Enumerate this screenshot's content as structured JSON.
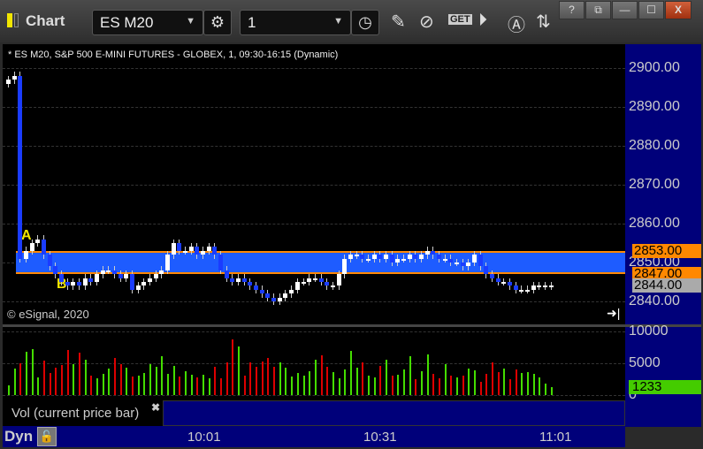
{
  "window": {
    "title": "Chart",
    "buttons": [
      "?",
      "⧉",
      "—",
      "☐",
      "X"
    ]
  },
  "toolbar": {
    "symbol": "ES M20",
    "interval": "1",
    "icons": [
      "settings-icon",
      "clock-icon",
      "pencil-icon",
      "studies-icon",
      "get-icon",
      "play-icon",
      "alert-icon",
      "link-icon"
    ]
  },
  "chart": {
    "info": "* ES M20, S&P 500 E-MINI FUTURES - GLOBEX, 1, 09:30-16:15 (Dynamic)",
    "copyright": "© eSignal, 2020",
    "price_ticks": [
      "2900.00",
      "2890.00",
      "2880.00",
      "2870.00",
      "2860.00",
      "2850.00",
      "2840.00"
    ],
    "price_values": [
      2900,
      2890,
      2880,
      2870,
      2860,
      2850,
      2840
    ],
    "zone": {
      "high": 2853,
      "low": 2847,
      "label_a": "A",
      "label_b": "B"
    },
    "price_labels": [
      {
        "text": "2853.00",
        "value": 2853,
        "color": "#ff8800"
      },
      {
        "text": "2847.00",
        "value": 2847,
        "color": "#ff8800"
      },
      {
        "text": "2844.00",
        "value": 2844,
        "color": "#aaaaaa"
      }
    ],
    "closes": [
      2897,
      2898,
      2851,
      2853,
      2855,
      2856,
      2852,
      2849,
      2847,
      2845,
      2844,
      2845,
      2844,
      2846,
      2845,
      2847,
      2848,
      2848,
      2847,
      2846,
      2847,
      2843,
      2844,
      2845,
      2846,
      2847,
      2848,
      2852,
      2855,
      2853,
      2853,
      2854,
      2852,
      2853,
      2854,
      2852,
      2848,
      2846,
      2845,
      2846,
      2845,
      2844,
      2843,
      2842,
      2841,
      2840,
      2841,
      2842,
      2843,
      2845,
      2845,
      2846,
      2846,
      2845,
      2844,
      2844,
      2847,
      2851,
      2852,
      2852,
      2851,
      2851,
      2852,
      2851,
      2852,
      2850,
      2851,
      2851,
      2852,
      2851,
      2852,
      2853,
      2852,
      2851,
      2851,
      2850,
      2850,
      2849,
      2850,
      2852,
      2849,
      2847,
      2846,
      2845,
      2845,
      2844,
      2843,
      2843,
      2843,
      2844,
      2844,
      2844,
      2844
    ]
  },
  "volume": {
    "ticks": [
      "10000",
      "5000",
      "0"
    ],
    "tick_values": [
      10000,
      5000,
      0
    ],
    "current": "1233",
    "study_label": "Vol (current price bar)",
    "values": [
      1500,
      4200,
      5000,
      6800,
      7200,
      2800,
      5400,
      3500,
      4300,
      4700,
      7100,
      4800,
      6600,
      5500,
      3000,
      2600,
      3300,
      4100,
      5900,
      4800,
      4300,
      2900,
      3100,
      3500,
      4900,
      4500,
      6100,
      3300,
      4600,
      2900,
      3800,
      3200,
      2800,
      3200,
      2700,
      4500,
      2700,
      5100,
      8800,
      7600,
      3000,
      5200,
      4400,
      5300,
      5800,
      4400,
      5100,
      4300,
      2900,
      3500,
      3100,
      3700,
      5500,
      6300,
      4400,
      3600,
      2700,
      4000,
      6900,
      4300,
      5200,
      3000,
      2800,
      4600,
      5500,
      3000,
      3200,
      4000,
      6100,
      2500,
      3700,
      6400,
      3300,
      2600,
      4800,
      3100,
      2800,
      3000,
      4100,
      3900,
      2100,
      3400,
      5200,
      3600,
      4200,
      2500,
      4000,
      3500,
      3600,
      3300,
      2800,
      1800,
      1233
    ]
  },
  "time_axis": {
    "labels": [
      "10:01",
      "10:31",
      "11:01"
    ],
    "mode": "Dyn"
  },
  "colors": {
    "up": "#ffffff",
    "down": "#1a3cff",
    "vol_up": "#44dd00",
    "vol_down": "#dd0000",
    "zone": "#1e5cff",
    "zone_border": "#ff8800",
    "axis_bg": "#00007a"
  }
}
